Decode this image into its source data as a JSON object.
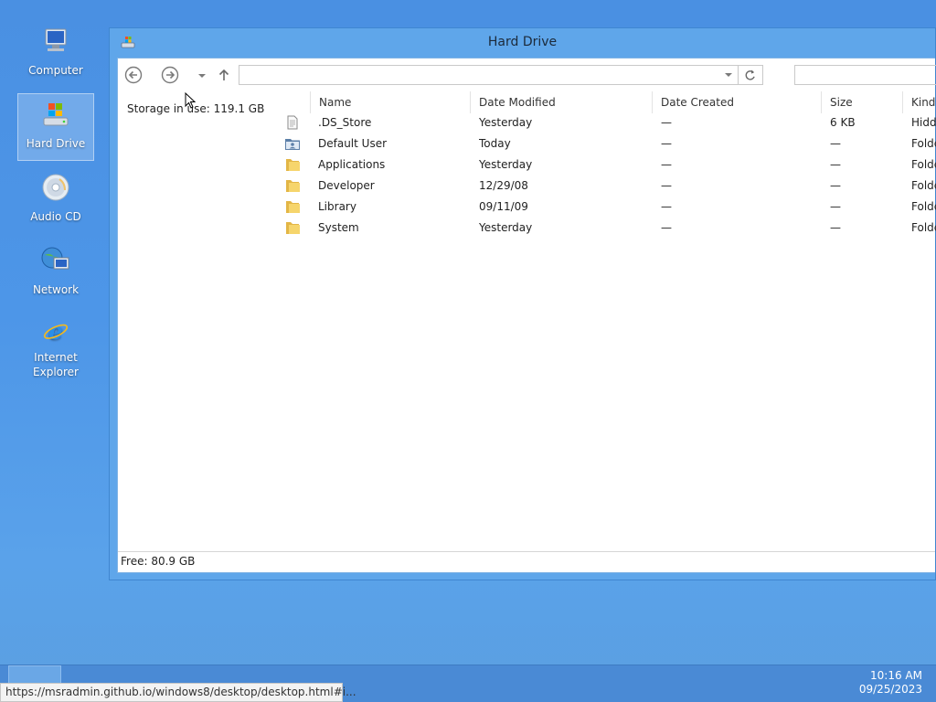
{
  "desktop": {
    "icons": [
      {
        "label": "Computer",
        "icon": "computer-icon"
      },
      {
        "label": "Hard Drive",
        "icon": "hard-drive-icon",
        "selected": true
      },
      {
        "label": "Audio CD",
        "icon": "cd-icon"
      },
      {
        "label": "Network",
        "icon": "network-icon"
      },
      {
        "label": "Internet Explorer",
        "icon": "internet-explorer-icon"
      }
    ]
  },
  "window": {
    "title": "Hard Drive",
    "address": {
      "value": ""
    },
    "search": {
      "value": ""
    },
    "storage_in_use": "Storage in use: 119.1 GB",
    "columns": [
      "Name",
      "Date Modified",
      "Date Created",
      "Size",
      "Kind"
    ],
    "files": [
      {
        "name": ".DS_Store",
        "modified": "Yesterday",
        "created": "—",
        "size": "6 KB",
        "kind": "Hidde",
        "icon": "document-icon"
      },
      {
        "name": "Default User",
        "modified": "Today",
        "created": "—",
        "size": "—",
        "kind": "Folde",
        "icon": "user-folder-icon"
      },
      {
        "name": "Applications",
        "modified": "Yesterday",
        "created": "—",
        "size": "—",
        "kind": "Folde",
        "icon": "folder-icon"
      },
      {
        "name": "Developer",
        "modified": "12/29/08",
        "created": "—",
        "size": "—",
        "kind": "Folde",
        "icon": "folder-icon"
      },
      {
        "name": "Library",
        "modified": "09/11/09",
        "created": "—",
        "size": "—",
        "kind": "Folde",
        "icon": "folder-icon"
      },
      {
        "name": "System",
        "modified": "Yesterday",
        "created": "—",
        "size": "—",
        "kind": "Folde",
        "icon": "folder-icon"
      }
    ],
    "free_space": "Free: 80.9 GB"
  },
  "taskbar": {
    "time": "10:16 AM",
    "date": "09/25/2023"
  },
  "status_url": "https://msradmin.github.io/windows8/desktop/desktop.html#i..."
}
